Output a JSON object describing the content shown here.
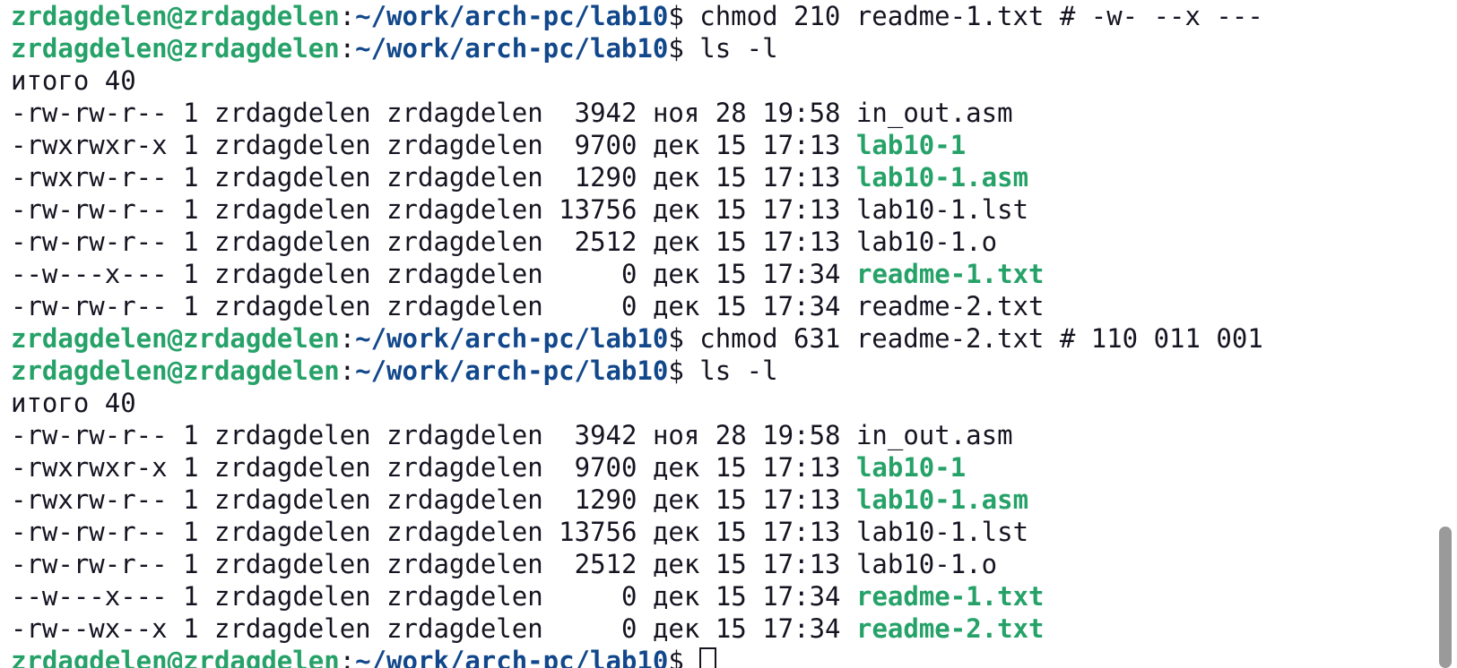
{
  "terminal": {
    "user_host": "zrdagdelen@zrdagdelen",
    "prompt_path": "~/work/arch-pc/lab10",
    "lines": [
      {
        "type": "prompt",
        "cmd": "chmod 210 readme-1.txt # -w- --x ---"
      },
      {
        "type": "prompt",
        "cmd": "ls -l"
      },
      {
        "type": "text",
        "text": "итого 40"
      },
      {
        "type": "file",
        "perms": "-rw-rw-r--",
        "links": "1",
        "owner": "zrdagdelen",
        "group": "zrdagdelen",
        "size": "3942",
        "month": "ноя",
        "day": "28",
        "time": "19:58",
        "name": "in_out.asm",
        "exec": false
      },
      {
        "type": "file",
        "perms": "-rwxrwxr-x",
        "links": "1",
        "owner": "zrdagdelen",
        "group": "zrdagdelen",
        "size": "9700",
        "month": "дек",
        "day": "15",
        "time": "17:13",
        "name": "lab10-1",
        "exec": true
      },
      {
        "type": "file",
        "perms": "-rwxrw-r--",
        "links": "1",
        "owner": "zrdagdelen",
        "group": "zrdagdelen",
        "size": "1290",
        "month": "дек",
        "day": "15",
        "time": "17:13",
        "name": "lab10-1.asm",
        "exec": true
      },
      {
        "type": "file",
        "perms": "-rw-rw-r--",
        "links": "1",
        "owner": "zrdagdelen",
        "group": "zrdagdelen",
        "size": "13756",
        "month": "дек",
        "day": "15",
        "time": "17:13",
        "name": "lab10-1.lst",
        "exec": false
      },
      {
        "type": "file",
        "perms": "-rw-rw-r--",
        "links": "1",
        "owner": "zrdagdelen",
        "group": "zrdagdelen",
        "size": "2512",
        "month": "дек",
        "day": "15",
        "time": "17:13",
        "name": "lab10-1.o",
        "exec": false
      },
      {
        "type": "file",
        "perms": "--w---x---",
        "links": "1",
        "owner": "zrdagdelen",
        "group": "zrdagdelen",
        "size": "0",
        "month": "дек",
        "day": "15",
        "time": "17:34",
        "name": "readme-1.txt",
        "exec": true
      },
      {
        "type": "file",
        "perms": "-rw-rw-r--",
        "links": "1",
        "owner": "zrdagdelen",
        "group": "zrdagdelen",
        "size": "0",
        "month": "дек",
        "day": "15",
        "time": "17:34",
        "name": "readme-2.txt",
        "exec": false
      },
      {
        "type": "prompt",
        "cmd": "chmod 631 readme-2.txt # 110 011 001"
      },
      {
        "type": "prompt",
        "cmd": "ls -l"
      },
      {
        "type": "text",
        "text": "итого 40"
      },
      {
        "type": "file",
        "perms": "-rw-rw-r--",
        "links": "1",
        "owner": "zrdagdelen",
        "group": "zrdagdelen",
        "size": "3942",
        "month": "ноя",
        "day": "28",
        "time": "19:58",
        "name": "in_out.asm",
        "exec": false
      },
      {
        "type": "file",
        "perms": "-rwxrwxr-x",
        "links": "1",
        "owner": "zrdagdelen",
        "group": "zrdagdelen",
        "size": "9700",
        "month": "дек",
        "day": "15",
        "time": "17:13",
        "name": "lab10-1",
        "exec": true
      },
      {
        "type": "file",
        "perms": "-rwxrw-r--",
        "links": "1",
        "owner": "zrdagdelen",
        "group": "zrdagdelen",
        "size": "1290",
        "month": "дек",
        "day": "15",
        "time": "17:13",
        "name": "lab10-1.asm",
        "exec": true
      },
      {
        "type": "file",
        "perms": "-rw-rw-r--",
        "links": "1",
        "owner": "zrdagdelen",
        "group": "zrdagdelen",
        "size": "13756",
        "month": "дек",
        "day": "15",
        "time": "17:13",
        "name": "lab10-1.lst",
        "exec": false
      },
      {
        "type": "file",
        "perms": "-rw-rw-r--",
        "links": "1",
        "owner": "zrdagdelen",
        "group": "zrdagdelen",
        "size": "2512",
        "month": "дек",
        "day": "15",
        "time": "17:13",
        "name": "lab10-1.o",
        "exec": false
      },
      {
        "type": "file",
        "perms": "--w---x---",
        "links": "1",
        "owner": "zrdagdelen",
        "group": "zrdagdelen",
        "size": "0",
        "month": "дек",
        "day": "15",
        "time": "17:34",
        "name": "readme-1.txt",
        "exec": true
      },
      {
        "type": "file",
        "perms": "-rw--wx--x",
        "links": "1",
        "owner": "zrdagdelen",
        "group": "zrdagdelen",
        "size": "0",
        "month": "дек",
        "day": "15",
        "time": "17:34",
        "name": "readme-2.txt",
        "exec": true
      },
      {
        "type": "prompt",
        "cmd": "",
        "cursor": true
      }
    ]
  },
  "colors": {
    "background": "#ffffff",
    "foreground": "#171421",
    "user_host": "#26a269",
    "path": "#12488b",
    "executable": "#26a269",
    "scrollbar": "#9a9a9a"
  }
}
